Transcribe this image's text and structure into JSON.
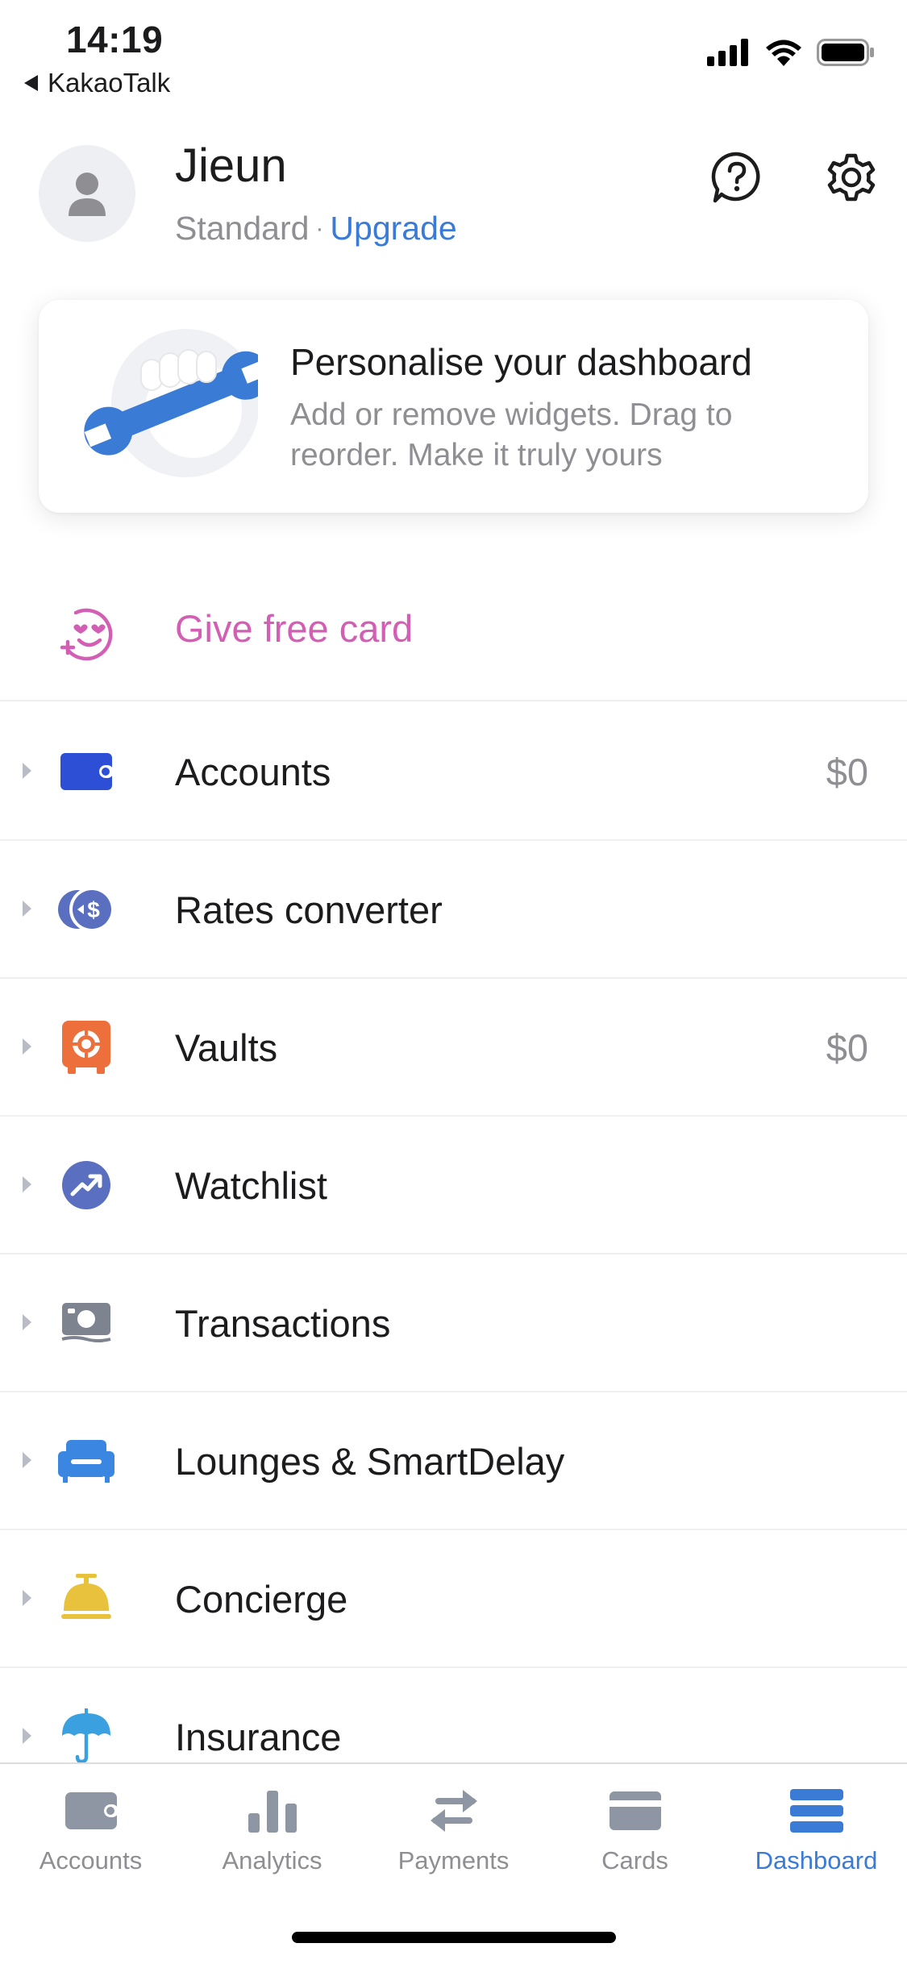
{
  "status_bar": {
    "time": "14:19",
    "back_app": "KakaoTalk",
    "icons": [
      "cellular-signal-icon",
      "wifi-icon",
      "battery-icon"
    ]
  },
  "header": {
    "user_name": "Jieun",
    "plan": "Standard",
    "separator": "·",
    "upgrade_label": "Upgrade",
    "icons": [
      "help-icon",
      "gear-icon"
    ]
  },
  "promo_card": {
    "title": "Personalise your dashboard",
    "description": "Add or remove widgets. Drag to reorder. Make it truly yours",
    "icon": "wrench-illustration"
  },
  "gift": {
    "label": "Give free card",
    "icon": "heart-eyes-face-icon",
    "color": "#d35fb4"
  },
  "widgets": [
    {
      "label": "Accounts",
      "value": "$0",
      "icon": "wallet-icon"
    },
    {
      "label": "Rates converter",
      "value": "",
      "icon": "currency-exchange-icon"
    },
    {
      "label": "Vaults",
      "value": "$0",
      "icon": "safe-icon"
    },
    {
      "label": "Watchlist",
      "value": "",
      "icon": "trending-up-icon"
    },
    {
      "label": "Transactions",
      "value": "",
      "icon": "banknote-icon"
    },
    {
      "label": "Lounges & SmartDelay",
      "value": "",
      "icon": "sofa-icon"
    },
    {
      "label": "Concierge",
      "value": "",
      "icon": "service-bell-icon"
    },
    {
      "label": "Insurance",
      "value": "",
      "icon": "umbrella-icon"
    }
  ],
  "tab_bar": {
    "tabs": [
      {
        "label": "Accounts",
        "icon": "wallet-icon",
        "active": false
      },
      {
        "label": "Analytics",
        "icon": "bar-chart-icon",
        "active": false
      },
      {
        "label": "Payments",
        "icon": "transfer-arrows-icon",
        "active": false
      },
      {
        "label": "Cards",
        "icon": "card-icon",
        "active": false
      },
      {
        "label": "Dashboard",
        "icon": "dashboard-icon",
        "active": true
      }
    ]
  },
  "colors": {
    "accent": "#3a7bd5",
    "secondary_text": "#8e8e93",
    "gift_pink": "#d35fb4"
  }
}
